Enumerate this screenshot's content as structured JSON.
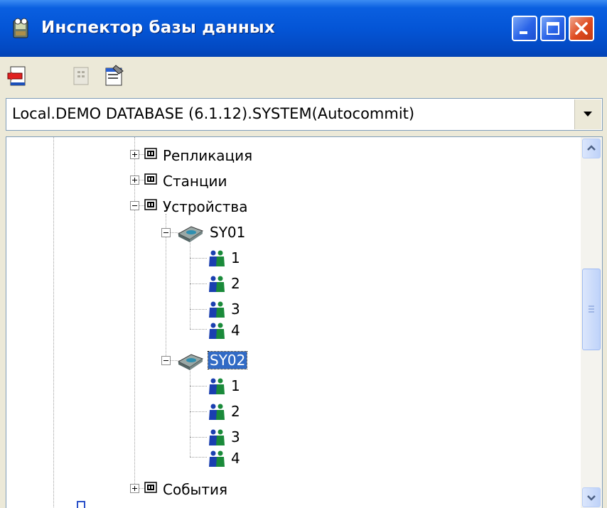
{
  "window": {
    "title": "Инспектор базы данных"
  },
  "toolbar": {
    "buttons": [
      {
        "icon": "disconnect-icon",
        "enabled": true
      },
      {
        "icon": "form-icon",
        "enabled": false
      },
      {
        "icon": "properties-icon",
        "enabled": true
      }
    ]
  },
  "connection": {
    "selected": "Local.DEMO DATABASE (6.1.12).SYSTEM(Autocommit)"
  },
  "tree": {
    "replication": "Репликация",
    "stations": "Станции",
    "devices": "Устройства",
    "device1": {
      "label": "SY01",
      "children": [
        "1",
        "2",
        "3",
        "4"
      ]
    },
    "device2": {
      "label": "SY02",
      "children": [
        "1",
        "2",
        "3",
        "4"
      ],
      "selected": true
    },
    "events": "События"
  },
  "colors": {
    "titlebar": "#0455d6",
    "selection": "#316ac5"
  }
}
